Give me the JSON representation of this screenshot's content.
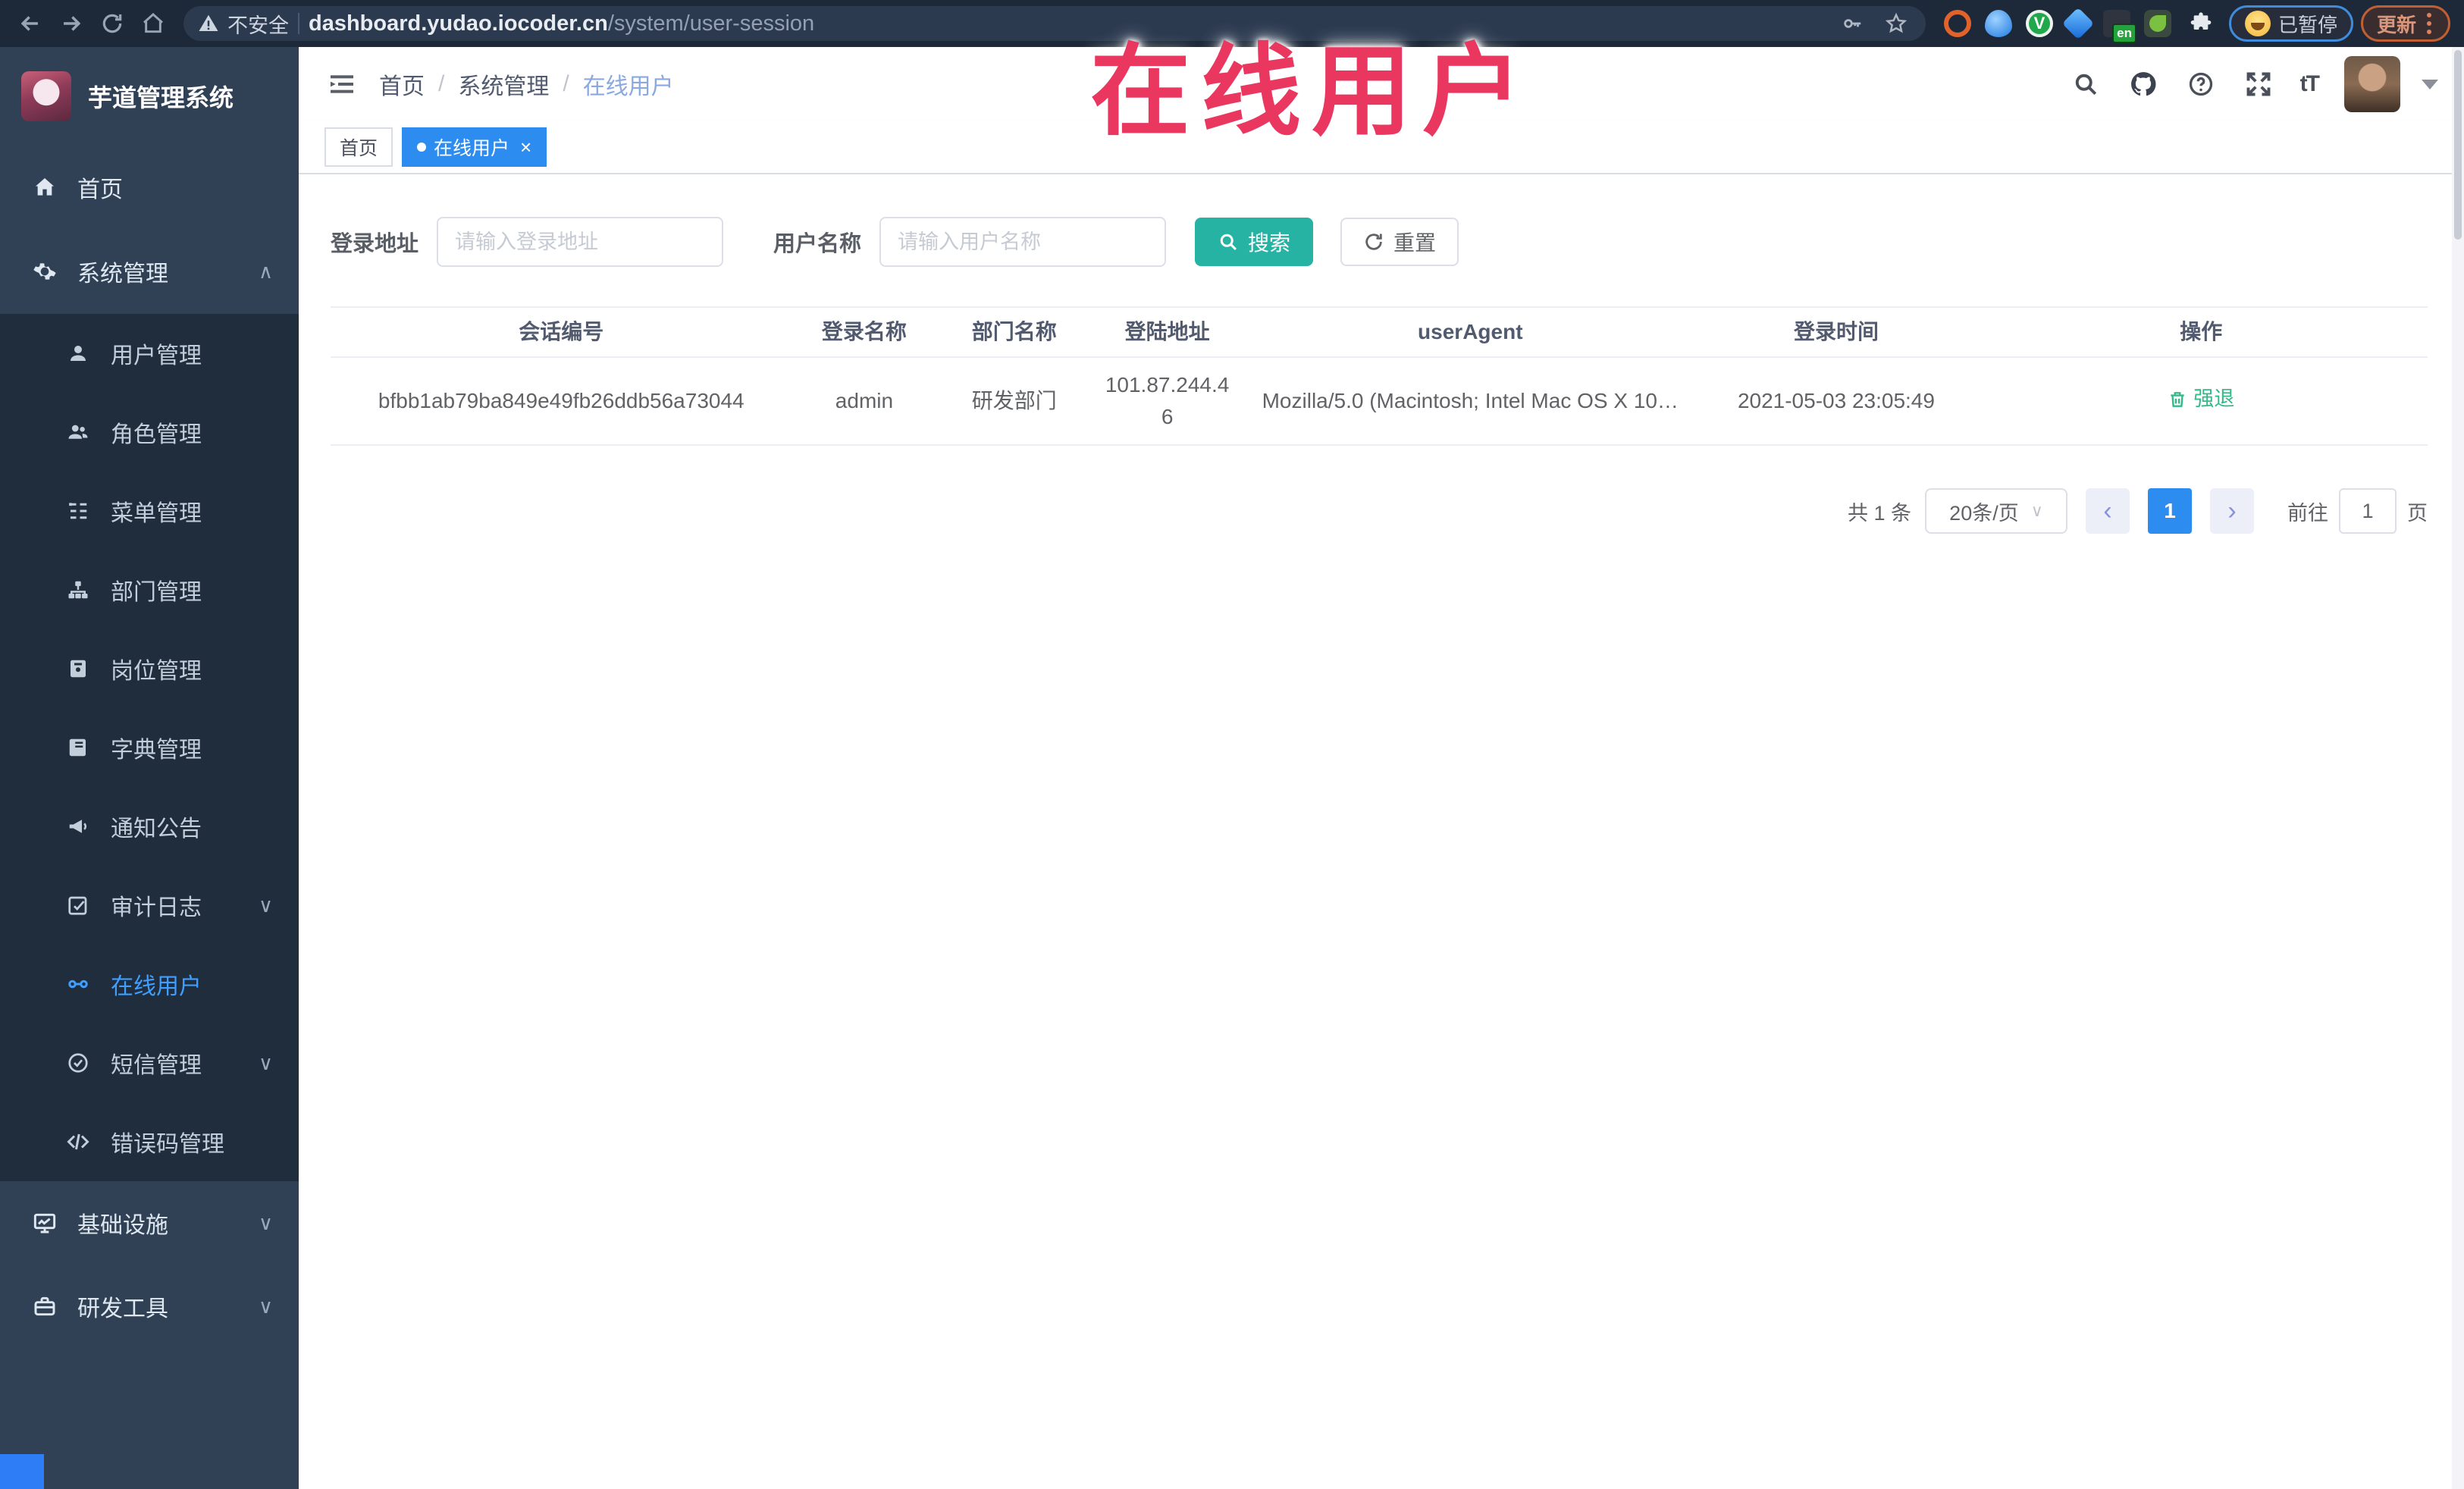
{
  "browser": {
    "security_label": "不安全",
    "url_host": "dashboard.yudao.iocoder.cn",
    "url_path": "/system/user-session",
    "paused_badge": "已暂停",
    "update_button": "更新"
  },
  "annotation": {
    "title": "在线用户"
  },
  "sidebar": {
    "app_title": "芋道管理系统",
    "items": [
      {
        "label": "首页"
      },
      {
        "label": "系统管理",
        "chevron": "up"
      },
      {
        "label": "用户管理"
      },
      {
        "label": "角色管理"
      },
      {
        "label": "菜单管理"
      },
      {
        "label": "部门管理"
      },
      {
        "label": "岗位管理"
      },
      {
        "label": "字典管理"
      },
      {
        "label": "通知公告"
      },
      {
        "label": "审计日志",
        "chevron": "down"
      },
      {
        "label": "在线用户",
        "active": true
      },
      {
        "label": "短信管理",
        "chevron": "down"
      },
      {
        "label": "错误码管理"
      },
      {
        "label": "基础设施",
        "chevron": "down"
      },
      {
        "label": "研发工具",
        "chevron": "down"
      }
    ]
  },
  "header": {
    "breadcrumb": [
      "首页",
      "系统管理",
      "在线用户"
    ]
  },
  "tags": {
    "home_label": "首页",
    "active_label": "在线用户"
  },
  "filters": {
    "login_address_label": "登录地址",
    "login_address_placeholder": "请输入登录地址",
    "username_label": "用户名称",
    "username_placeholder": "请输入用户名称",
    "search_label": "搜索",
    "reset_label": "重置"
  },
  "table": {
    "columns": [
      "会话编号",
      "登录名称",
      "部门名称",
      "登陆地址",
      "userAgent",
      "登录时间",
      "操作"
    ],
    "rows": [
      {
        "session_id": "bfbb1ab79ba849e49fb26ddb56a73044",
        "username": "admin",
        "dept": "研发部门",
        "ip": "101.87.244.46",
        "user_agent": "Mozilla/5.0 (Macintosh; Intel Mac OS X 10…",
        "login_time": "2021-05-03 23:05:49",
        "action_label": "强退"
      }
    ]
  },
  "pagination": {
    "total": "共 1 条",
    "page_size": "20条/页",
    "current_page": "1",
    "goto_label": "前往",
    "goto_value": "1",
    "page_unit": "页"
  },
  "glyphs": {
    "chevron_up": "∧",
    "chevron_down": "∨",
    "breadcrumb_sep": "/",
    "tag_close": "×",
    "font_size_icon": "tT",
    "prev": "‹",
    "next": "›",
    "select_caret": "∨"
  },
  "colors": {
    "theme_teal": "#26b3a4",
    "active_blue": "#2d8cf0",
    "sidebar_bg": "#304156",
    "submenu_bg": "#1f2d3d",
    "annotation_red": "#e9375f",
    "action_green": "#35b98a"
  }
}
